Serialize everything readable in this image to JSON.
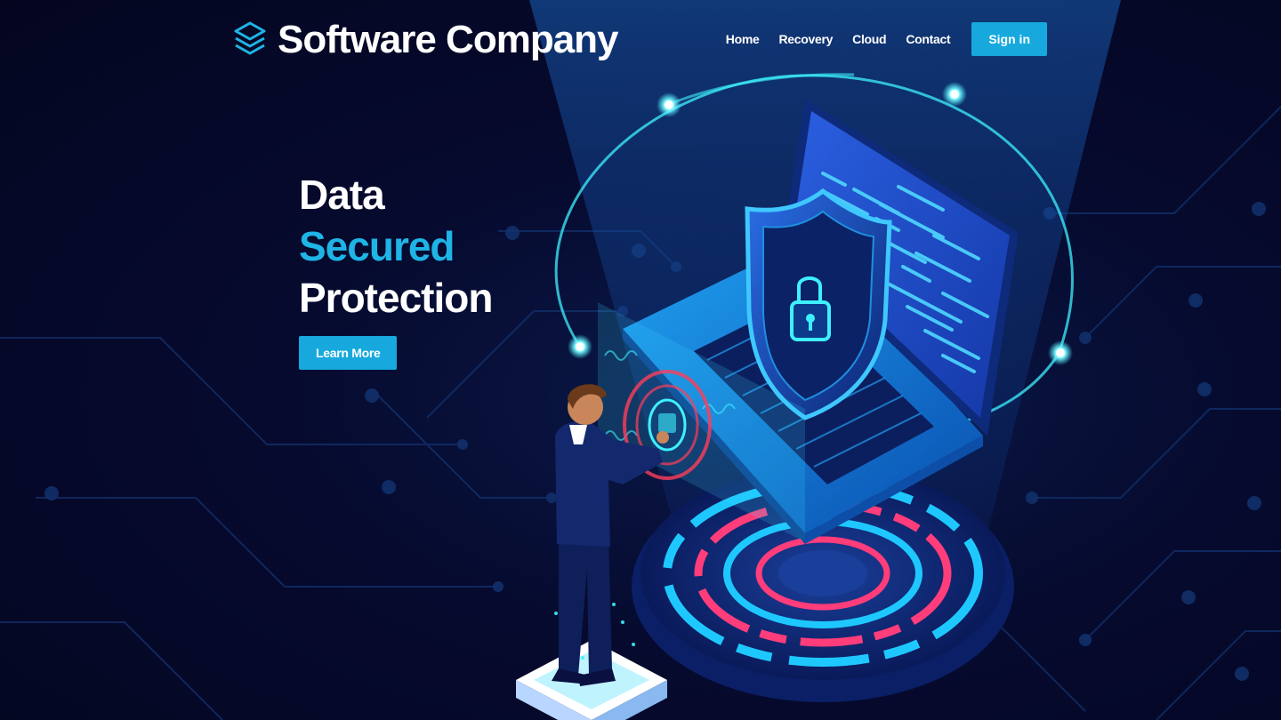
{
  "brand": {
    "name": "Software Company",
    "logo_icon": "layers-icon"
  },
  "nav": {
    "items": [
      {
        "label": "Home"
      },
      {
        "label": "Recovery"
      },
      {
        "label": "Cloud"
      },
      {
        "label": "Contact"
      }
    ],
    "signin_label": "Sign in"
  },
  "hero": {
    "title_line1": "Data",
    "title_line2": "Secured",
    "title_line3": "Protection",
    "cta_label": "Learn More"
  },
  "illustration": {
    "icons": [
      "shield-lock-icon",
      "laptop-icon",
      "padlock-icon",
      "fingerprint-touch-icon"
    ]
  },
  "colors": {
    "accent": "#17a9de",
    "accent_text": "#1fb4e6",
    "background": "#060a2e",
    "glow_cyan": "#3ef0ff",
    "ring_pink": "#ff3d7a"
  }
}
